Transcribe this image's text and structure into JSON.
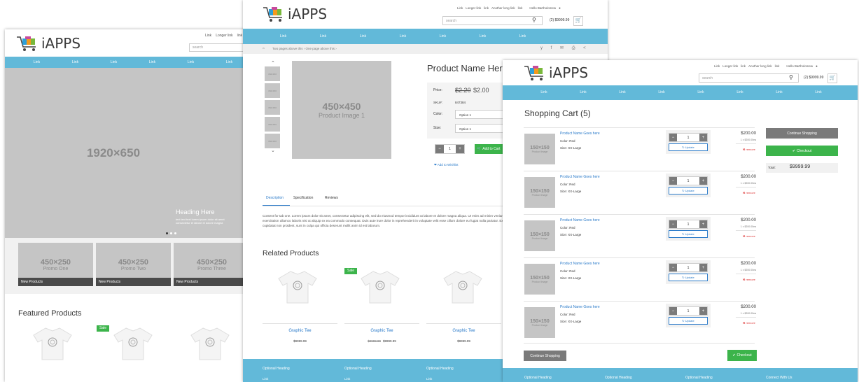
{
  "brand": "iAPPS",
  "links": [
    "Link",
    "Longer link",
    "link",
    "Another long link",
    "link"
  ],
  "search_placeholder": "search",
  "greeting": "Hello Bartholomew",
  "cart_total": "(2) $9999.99",
  "nav_link": "Link",
  "home": {
    "hero_text": "1920×650",
    "hero_heading": "Heading Here",
    "hero_sub": "text text text lorem ipsum dolor sit amet\nconsectetur et labore et dolore magna",
    "promos": [
      {
        "dim": "450×250",
        "name": "Promo One",
        "label": "New Products"
      },
      {
        "dim": "450×250",
        "name": "Promo Two",
        "label": "New Products"
      },
      {
        "dim": "450×250",
        "name": "Promo Three",
        "label": "New Products"
      }
    ],
    "featured_title": "Featured Products",
    "sale_badge": "Sale"
  },
  "product": {
    "breadcrumb": "Two pages above this  ›  One page above this  ›",
    "name": "Product Name Here",
    "image_dim": "450×450",
    "image_label": "Product Image 1",
    "thumb_label": "150×150",
    "price_label": "Price:",
    "old_price": "$2.20",
    "price": "$2.00",
    "sku_label": "SKU#:",
    "sku": "847384",
    "color_label": "Color:",
    "size_label": "Size:",
    "option": "Option 1",
    "qty": "1",
    "add_to_cart": "Add to Cart",
    "wishlist": "Add to Wishlist",
    "tabs": [
      "Description",
      "Specification",
      "Reviews"
    ],
    "description": "Content for tab one. Lorem ipsum dolor sit amet, consectetur adipiscing elit, sed do eiusmod tempor incididunt ut labore et dolore magna aliqua. Ut enim ad minim veniam, quis nostrud exercitation ullamco laboris nisi ut aliquip ex ea commodo consequat. Duis aute irure dolor in reprehenderit in voluptate velit esse cillum dolore eu fugiat nulla pariatur. Excepteur sint occaecat cupidatat non proident, sunt in culpa qui officia deserunt mollit anim id est laborum.",
    "related_title": "Related Products",
    "related": [
      {
        "name": "Graphic Tee",
        "price": "$9999.99",
        "old": ""
      },
      {
        "name": "Graphic Tee",
        "price": "$9999.99",
        "old": "$9999.99"
      },
      {
        "name": "Graphic Tee",
        "price": "$9999.99",
        "old": ""
      }
    ],
    "sale_badge": "Sale",
    "footer_headings": [
      "Optional Heading",
      "Optional Heading",
      "Optional Heading"
    ],
    "footer_link": "Link"
  },
  "cart": {
    "title": "Shopping Cart (5)",
    "items": [
      {
        "name": "Product Name Goes here",
        "color": "Color: Red",
        "size": "Size: XX-Large",
        "qty": "1",
        "price": "$200.00",
        "each": "1 x $200.00ea"
      },
      {
        "name": "Product Name Goes here",
        "color": "Color: Red",
        "size": "Size: XX-Large",
        "qty": "1",
        "price": "$200.00",
        "each": "1 x $200.00ea"
      },
      {
        "name": "Product Name Goes here",
        "color": "Color: Red",
        "size": "Size: XX-Large",
        "qty": "1",
        "price": "$200.00",
        "each": "1 x $200.00ea"
      },
      {
        "name": "Product Name Goes here",
        "color": "Color: Red",
        "size": "Size: XX-Large",
        "qty": "1",
        "price": "$200.00",
        "each": "1 x $200.00ea"
      },
      {
        "name": "Product Name Goes here",
        "color": "Color: Red",
        "size": "Size: XX-Large",
        "qty": "1",
        "price": "$200.00",
        "each": "1 x $200.00ea"
      }
    ],
    "thumb_dim": "150×150",
    "thumb_label": "Product Image",
    "update": "Update",
    "remove": "remove",
    "continue": "Continue Shopping",
    "checkout": "Checkout",
    "total_label": "Total:",
    "total": "$9999.99",
    "footer_headings": [
      "Optional Heading",
      "Optional Heading",
      "Optional Heading",
      "Connect With Us"
    ]
  },
  "colors": {
    "nav": "#62b9d9",
    "green": "#3cb44b",
    "link": "#2a7ac9",
    "placeholder": "#c5c5c5"
  }
}
